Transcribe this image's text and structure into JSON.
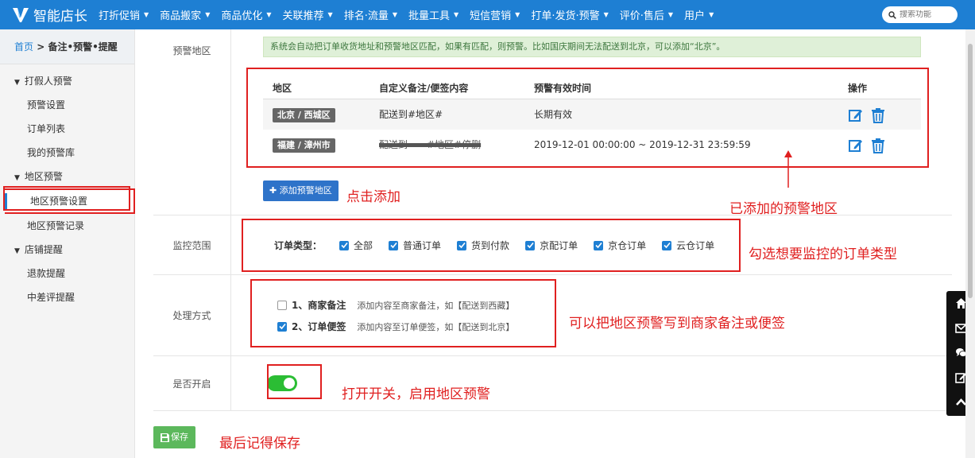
{
  "topbar": {
    "app_name": "智能店长",
    "menu": [
      "打折促销",
      "商品搬家",
      "商品优化",
      "关联推荐",
      "排名·流量",
      "批量工具",
      "短信营销",
      "打单·发货·预警",
      "评价·售后",
      "用户"
    ],
    "search_placeholder": "搜索功能"
  },
  "sidebar": {
    "crumb_home": "首页",
    "crumb_sep": " > ",
    "crumb_current": "备注•预警•提醒",
    "groups": [
      {
        "label": "打假人预警",
        "items": [
          "预警设置",
          "订单列表",
          "我的预警库"
        ]
      },
      {
        "label": "地区预警",
        "items": [
          "地区预警设置",
          "地区预警记录"
        ]
      },
      {
        "label": "店铺提醒",
        "items": [
          "退款提醒",
          "中差评提醒"
        ]
      }
    ]
  },
  "region": {
    "label": "预警地区",
    "tip": "系统会自动把订单收货地址和预警地区匹配，如果有匹配，则预警。比如国庆期间无法配送到北京，可以添加“北京”。",
    "headers": [
      "地区",
      "自定义备注/便签内容",
      "预警有效时间",
      "操作"
    ],
    "rows": [
      {
        "area": "北京 / 西城区",
        "note": "配送到#地区#",
        "time": "长期有效"
      },
      {
        "area": "福建 / 漳州市",
        "note": "配送到——#地区#停删",
        "time": "2019-12-01 00:00:00 ~ 2019-12-31 23:59:59"
      }
    ],
    "add_button": "添加预警地区"
  },
  "monitor": {
    "label": "监控范围",
    "type_label": "订单类型：",
    "options": [
      "全部",
      "普通订单",
      "货到付款",
      "京配订单",
      "京仓订单",
      "云仓订单"
    ]
  },
  "handling": {
    "label": "处理方式",
    "options": [
      {
        "title": "1、商家备注",
        "desc": "添加内容至商家备注，如【配送到西藏】",
        "checked": false
      },
      {
        "title": "2、订单便签",
        "desc": "添加内容至订单便签，如【配送到北京】",
        "checked": true
      }
    ]
  },
  "enable": {
    "label": "是否开启",
    "on": true
  },
  "save_button": "保存",
  "annotations": {
    "click_add": "点击添加",
    "added_regions": "已添加的预警地区",
    "select_types": "勾选想要监控的订单类型",
    "write_note": "可以把地区预警写到商家备注或便签",
    "turn_on": "打开开关，启用地区预警",
    "remember_save": "最后记得保存"
  },
  "colors": {
    "nav": "#1e7fd3",
    "annotation": "#e02020",
    "toggle": "#2bbd34",
    "save": "#5cb85c"
  }
}
